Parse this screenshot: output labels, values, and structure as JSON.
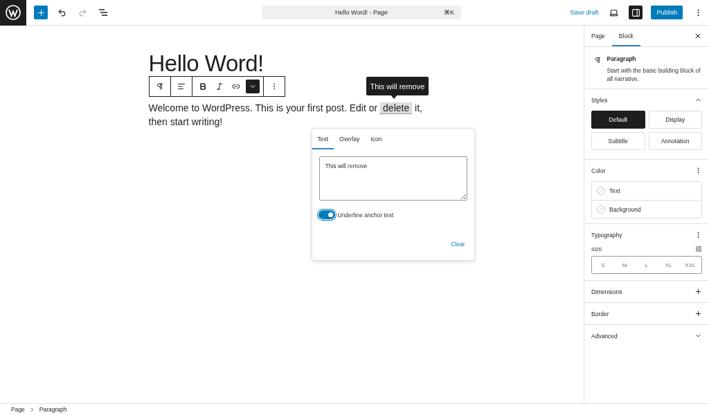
{
  "topbar": {
    "title": "Hello Word! - Page",
    "shortcut": "⌘K",
    "save_draft": "Save draft",
    "publish": "Publish",
    "settings_on": true
  },
  "editor": {
    "title": "Hello Word!",
    "text_before": "Welcome to WordPress. This is your first post. Edit or ",
    "highlight": "delete",
    "text_after": " it, then start writing!",
    "tooltip": "This will remove"
  },
  "toolbar": {
    "items": [
      {
        "kind": "paragraph",
        "selected": false
      },
      {
        "kind": "align",
        "selected": false
      },
      {
        "kind": "bold",
        "selected": false
      },
      {
        "kind": "italic",
        "selected": false
      },
      {
        "kind": "link",
        "selected": false
      },
      {
        "kind": "chevron",
        "selected": true
      },
      {
        "kind": "more",
        "selected": false
      }
    ]
  },
  "popover": {
    "tabs": [
      {
        "label": "Text",
        "selected": true
      },
      {
        "label": "Overlay",
        "selected": false
      },
      {
        "label": "Icon",
        "selected": false
      }
    ],
    "value": "This will remove",
    "toggle": {
      "label": "Underline anchor text",
      "on": true
    },
    "clear": "Clear"
  },
  "sidebar": {
    "tabs": [
      {
        "label": "Page",
        "selected": false
      },
      {
        "label": "Block",
        "selected": true
      }
    ],
    "block": {
      "name": "Paragraph",
      "description": "Start with the basic building block of all narrative."
    },
    "styles": {
      "title": "Styles",
      "expanded": true,
      "options": [
        {
          "label": "Default",
          "selected": true
        },
        {
          "label": "Display",
          "selected": false
        },
        {
          "label": "Subtitle",
          "selected": false
        },
        {
          "label": "Annotation",
          "selected": false
        }
      ]
    },
    "color": {
      "title": "Color",
      "items": [
        "Text",
        "Background"
      ]
    },
    "typography": {
      "title": "Typography",
      "size_label": "SIZE",
      "sizes": [
        {
          "label": "S",
          "selected": false
        },
        {
          "label": "M",
          "selected": false
        },
        {
          "label": "L",
          "selected": false
        },
        {
          "label": "XL",
          "selected": false
        },
        {
          "label": "XXL",
          "selected": false
        }
      ]
    },
    "panels": [
      {
        "title": "Dimensions",
        "kind": "plus"
      },
      {
        "title": "Border",
        "kind": "plus"
      },
      {
        "title": "Advanced",
        "kind": "chevron"
      }
    ]
  },
  "breadcrumb": [
    "Page",
    "Paragraph"
  ]
}
